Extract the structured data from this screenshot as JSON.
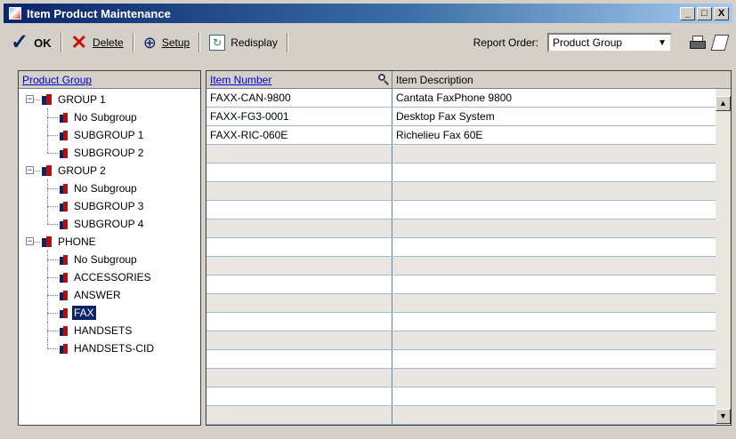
{
  "window": {
    "title": "Item Product Maintenance",
    "minimize": "_",
    "maximize": "□",
    "close": "X"
  },
  "toolbar": {
    "ok_label": "OK",
    "delete_label": "Delete",
    "setup_label": "Setup",
    "redisplay_label": "Redisplay",
    "report_order_label": "Report Order:",
    "report_order_value": "Product Group"
  },
  "left_panel": {
    "header": "Product Group",
    "tree": [
      {
        "label": "GROUP 1",
        "level": 0,
        "expanded": true
      },
      {
        "label": "No Subgroup",
        "level": 1
      },
      {
        "label": "SUBGROUP 1",
        "level": 1
      },
      {
        "label": "SUBGROUP 2",
        "level": 1
      },
      {
        "label": "GROUP 2",
        "level": 0,
        "expanded": true
      },
      {
        "label": "No Subgroup",
        "level": 1
      },
      {
        "label": "SUBGROUP 3",
        "level": 1
      },
      {
        "label": "SUBGROUP 4",
        "level": 1
      },
      {
        "label": "PHONE",
        "level": 0,
        "expanded": true
      },
      {
        "label": "No Subgroup",
        "level": 1
      },
      {
        "label": "ACCESSORIES",
        "level": 1
      },
      {
        "label": "ANSWER",
        "level": 1
      },
      {
        "label": "FAX",
        "level": 1,
        "selected": true
      },
      {
        "label": "HANDSETS",
        "level": 1
      },
      {
        "label": "HANDSETS-CID",
        "level": 1
      }
    ]
  },
  "grid": {
    "columns": [
      "Item Number",
      "Item Description"
    ],
    "rows": [
      {
        "item_number": "FAXX-CAN-9800",
        "description": "Cantata FaxPhone 9800"
      },
      {
        "item_number": "FAXX-FG3-0001",
        "description": "Desktop Fax System"
      },
      {
        "item_number": "FAXX-RIC-060E",
        "description": "Richelieu Fax 60E"
      },
      {
        "item_number": "",
        "description": ""
      },
      {
        "item_number": "",
        "description": ""
      },
      {
        "item_number": "",
        "description": ""
      },
      {
        "item_number": "",
        "description": ""
      },
      {
        "item_number": "",
        "description": ""
      },
      {
        "item_number": "",
        "description": ""
      },
      {
        "item_number": "",
        "description": ""
      },
      {
        "item_number": "",
        "description": ""
      },
      {
        "item_number": "",
        "description": ""
      },
      {
        "item_number": "",
        "description": ""
      },
      {
        "item_number": "",
        "description": ""
      },
      {
        "item_number": "",
        "description": ""
      },
      {
        "item_number": "",
        "description": ""
      },
      {
        "item_number": "",
        "description": ""
      },
      {
        "item_number": "",
        "description": ""
      }
    ]
  }
}
